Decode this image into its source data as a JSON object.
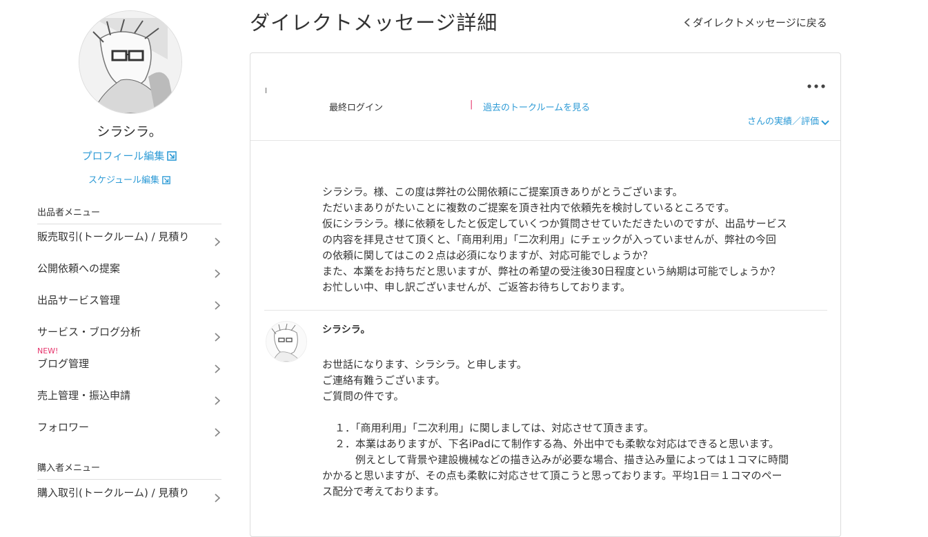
{
  "page": {
    "title": "ダイレクトメッセージ詳細",
    "back_label": "ダイレクトメッセージに戻る"
  },
  "profile": {
    "name": "シラシラ。",
    "profile_edit_label": "プロフィール編集",
    "schedule_edit_label": "スケジュール編集"
  },
  "seller_menu": {
    "heading": "出品者メニュー",
    "items": [
      {
        "label": "販売取引(トークルーム) / 見積り"
      },
      {
        "label": "公開依頼への提案"
      },
      {
        "label": "出品サービス管理"
      },
      {
        "label": "サービス・ブログ分析"
      },
      {
        "label": "ブログ管理",
        "badge": "NEW!"
      },
      {
        "label": "売上管理・振込申請"
      },
      {
        "label": "フォロワー"
      }
    ]
  },
  "buyer_menu": {
    "heading": "購入者メニュー",
    "items": [
      {
        "label": "購入取引(トークルーム) / 見積り"
      }
    ]
  },
  "thread_header": {
    "last_login_label": "最終ログイン",
    "separator": "|",
    "past_rooms_label": "過去のトークルームを見る",
    "record_label": "さんの実績／評価"
  },
  "message1": {
    "lines": [
      "シラシラ。様、この度は弊社の公開依頼にご提案頂きありがとうございます。",
      "ただいまありがたいことに複数のご提案を頂き社内で依頼先を検討しているところです。",
      "仮にシラシラ。様に依頼をしたと仮定していくつか質問させていただきたいのですが、出品サービス",
      "の内容を拝見させて頂くと、「商用利用」「二次利用」にチェックが入っていませんが、弊社の今回",
      "の依頼に関してはこの２点は必須になりますが、対応可能でしょうか？",
      "また、本業をお持ちだと思いますが、弊社の希望の受注後30日程度という納期は可能でしょうか？",
      "お忙しい中、申し訳ございませんが、ご返答お待ちしております。"
    ]
  },
  "message2": {
    "sender": "シラシラ。",
    "lines": [
      "お世話になります、シラシラ。と申します。",
      "ご連絡有難うございます。",
      "ご質問の件です。",
      "",
      "１．「商用利用」「二次利用」に関しましては、対応させて頂きます。",
      "２．本業はありますが、下名iPadにて制作する為、外出中でも柔軟な対応はできると思います。",
      "例えとして背景や建設機械などの描き込みが必要な場合、描き込み量によっては１コマに時間",
      "かかると思いますが、その点も柔軟に対応させて頂こうと思っております。平均1日＝１コマのペー",
      "ス配分で考えております。"
    ]
  },
  "colors": {
    "link": "#2e9bd6",
    "accent_pink": "#e6336b",
    "text": "#333333",
    "border": "#dcdcdc"
  },
  "icons": {
    "external": "external-link-icon",
    "chevron_right": "chevron-right-icon",
    "chevron_left": "chevron-left-icon",
    "chevron_down": "chevron-down-icon",
    "more": "more-horizontal-icon"
  }
}
